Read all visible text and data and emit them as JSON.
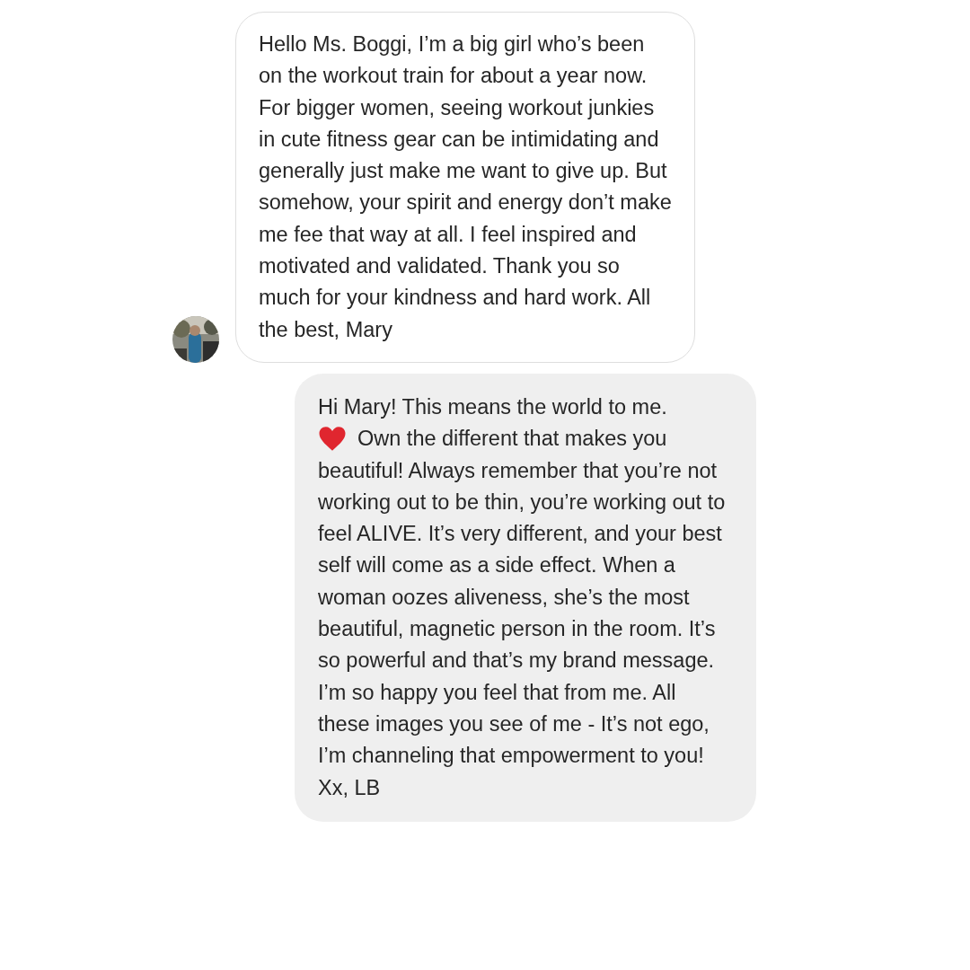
{
  "messages": [
    {
      "kind": "received",
      "text": "Hello Ms. Boggi, I’m a big girl who’s been on the workout train for about a year now. For bigger women, seeing workout junkies in cute fitness gear can be intimidating and generally just make me want to give up. But somehow, your spirit and energy don’t make me fee that way at all. I feel inspired and motivated and validated. Thank you so much for your kindness and hard work. All the best, Mary"
    },
    {
      "kind": "sent",
      "text_before_heart": "Hi Mary! This means the world to me.",
      "text_after_heart": "Own the different that makes you",
      "text_rest": "beautiful! Always remember that you’re not working out to be thin, you’re working out to feel ALIVE. It’s very different, and your best self will come as a side effect. When a woman oozes aliveness, she’s the most beautiful, magnetic person in the room. It’s so powerful and that’s my brand message. I’m so happy you feel that from me. All these images you see of me - It’s not ego, I’m channeling that empowerment to you!  Xx, LB"
    }
  ]
}
